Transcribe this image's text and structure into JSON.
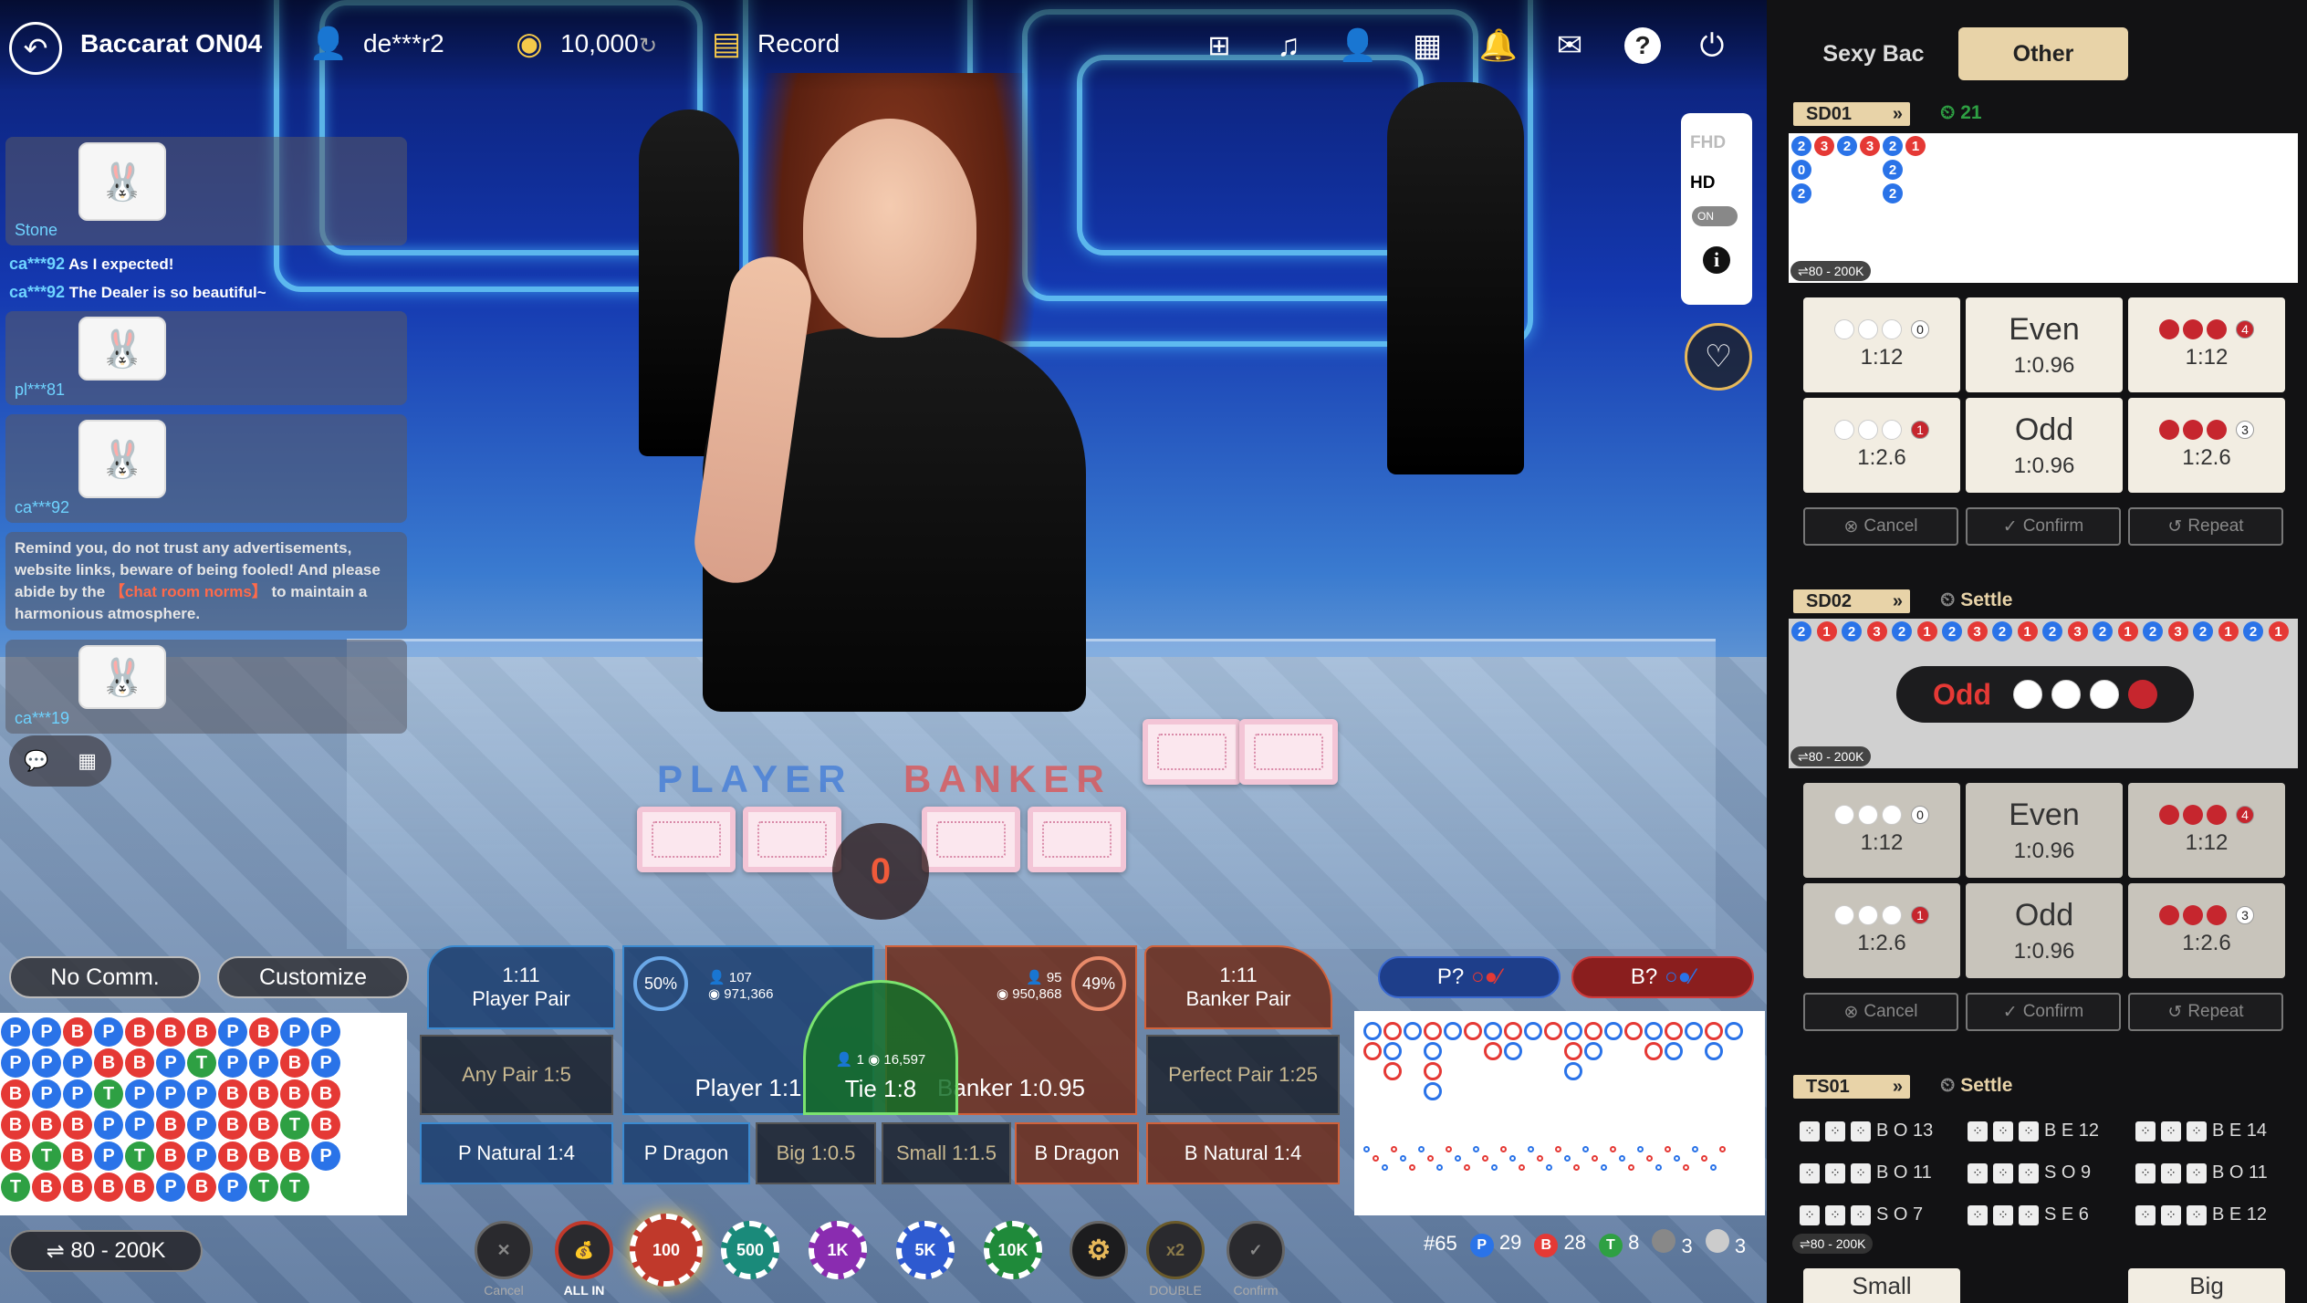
{
  "header": {
    "title": "Baccarat ON04",
    "user": "de***r2",
    "balance": "10,000",
    "record": "Record"
  },
  "chat": {
    "stone_user": "Stone",
    "messages": [
      {
        "user": "ca***92",
        "text": "As I expected!"
      },
      {
        "user": "ca***92",
        "text": "The Dealer is so beautiful~"
      }
    ],
    "sticker_users": [
      "pl***81",
      "ca***92",
      "ca***19"
    ],
    "notice_a": "Remind you, do not trust any advertisements, website links, beware of being fooled!  And please abide by the",
    "notice_link": "【chat room norms】",
    "notice_b": "to maintain a harmonious atmosphere."
  },
  "quality": {
    "fhd": "FHD",
    "hd": "HD",
    "toggle": "ON"
  },
  "counter": "0",
  "table_labels": {
    "player": "PLAYER",
    "banker": "BANKER"
  },
  "controls": {
    "no_comm": "No Comm.",
    "customize": "Customize",
    "limit": "80 - 200K"
  },
  "bets": {
    "player_pair": {
      "odds": "1:11",
      "label": "Player Pair"
    },
    "banker_pair": {
      "odds": "1:11",
      "label": "Banker Pair"
    },
    "any_pair": "Any Pair 1:5",
    "perfect_pair": "Perfect Pair 1:25",
    "player": {
      "label": "Player 1:1",
      "pct": "50%",
      "count": "107",
      "amount": "971,366"
    },
    "banker": {
      "label": "Banker 1:0.95",
      "pct": "49%",
      "count": "95",
      "amount": "950,868"
    },
    "tie": {
      "label": "Tie 1:8",
      "count": "1",
      "amount": "16,597"
    },
    "p_natural": "P Natural 1:4",
    "p_dragon": "P Dragon",
    "big": "Big 1:0.5",
    "small": "Small 1:1.5",
    "b_dragon": "B Dragon",
    "b_natural": "B Natural 1:4"
  },
  "chips": {
    "cancel": "Cancel",
    "all_in": "ALL IN",
    "values": [
      "100",
      "500",
      "1K",
      "5K",
      "10K"
    ],
    "double": "DOUBLE",
    "confirm": "Confirm"
  },
  "ask": {
    "player": "P?",
    "banker": "B?"
  },
  "stats": {
    "round": "#65",
    "player": "29",
    "banker": "28",
    "tie": "8",
    "p_pair": "3",
    "b_pair": "3",
    "p_letter": "P",
    "b_letter": "B",
    "t_letter": "T"
  },
  "bead_road": [
    [
      "P",
      "P",
      "B",
      "P",
      "B",
      "B",
      "B",
      "P",
      "B",
      "P",
      "P"
    ],
    [
      "P",
      "P",
      "P",
      "B",
      "B",
      "P",
      "T",
      "P",
      "P",
      "B",
      "P"
    ],
    [
      "B",
      "P",
      "P",
      "T",
      "P",
      "P",
      "P",
      "B",
      "B",
      "B",
      "B"
    ],
    [
      "B",
      "B",
      "B",
      "P",
      "P",
      "B",
      "P",
      "B",
      "B",
      "T",
      "B"
    ],
    [
      "B",
      "T",
      "B",
      "P",
      "T",
      "B",
      "P",
      "B",
      "B",
      "B",
      "P"
    ],
    [
      "T",
      "B",
      "B",
      "B",
      "B",
      "P",
      "B",
      "P",
      "T",
      "T",
      ""
    ]
  ],
  "panel": {
    "tabs": [
      "Sexy Bac",
      "Other"
    ],
    "tables": [
      {
        "name": "SD01",
        "status": "21",
        "limit": "80 - 200K"
      },
      {
        "name": "SD02",
        "status": "Settle",
        "limit": "80 - 200K"
      },
      {
        "name": "TS01",
        "status": "Settle",
        "limit": "80 - 200K"
      }
    ],
    "sicbo": {
      "b0": {
        "n": "0",
        "odds": "1:12"
      },
      "even": {
        "label": "Even",
        "odds": "1:0.96"
      },
      "b4": {
        "n": "4",
        "odds": "1:12"
      },
      "b1": {
        "n": "1",
        "odds": "1:2.6"
      },
      "odd": {
        "label": "Odd",
        "odds": "1:0.96"
      },
      "b3": {
        "n": "3",
        "odds": "1:2.6"
      }
    },
    "actions": {
      "cancel": "Cancel",
      "confirm": "Confirm",
      "repeat": "Repeat"
    },
    "sd02_result": "Odd",
    "sd01_beads": [
      [
        "2",
        "0",
        "2"
      ],
      [
        "3"
      ],
      [
        "2"
      ],
      [
        "3"
      ],
      [
        "2",
        "2",
        "2"
      ],
      [
        "1"
      ]
    ],
    "ts01_rows": [
      [
        "B",
        "O",
        "13",
        "B",
        "E",
        "12",
        "B",
        "E",
        "14"
      ],
      [
        "B",
        "O",
        "11",
        "S",
        "O",
        "9",
        "B",
        "O",
        "11"
      ],
      [
        "S",
        "O",
        "7",
        "S",
        "E",
        "6",
        "B",
        "E",
        "12"
      ]
    ],
    "ts01_bottom": [
      "Small",
      "Big"
    ]
  },
  "colors": {
    "player": "#2a73e8",
    "banker": "#e53935",
    "tie": "#2ea043",
    "gold": "#e8d3a8"
  }
}
